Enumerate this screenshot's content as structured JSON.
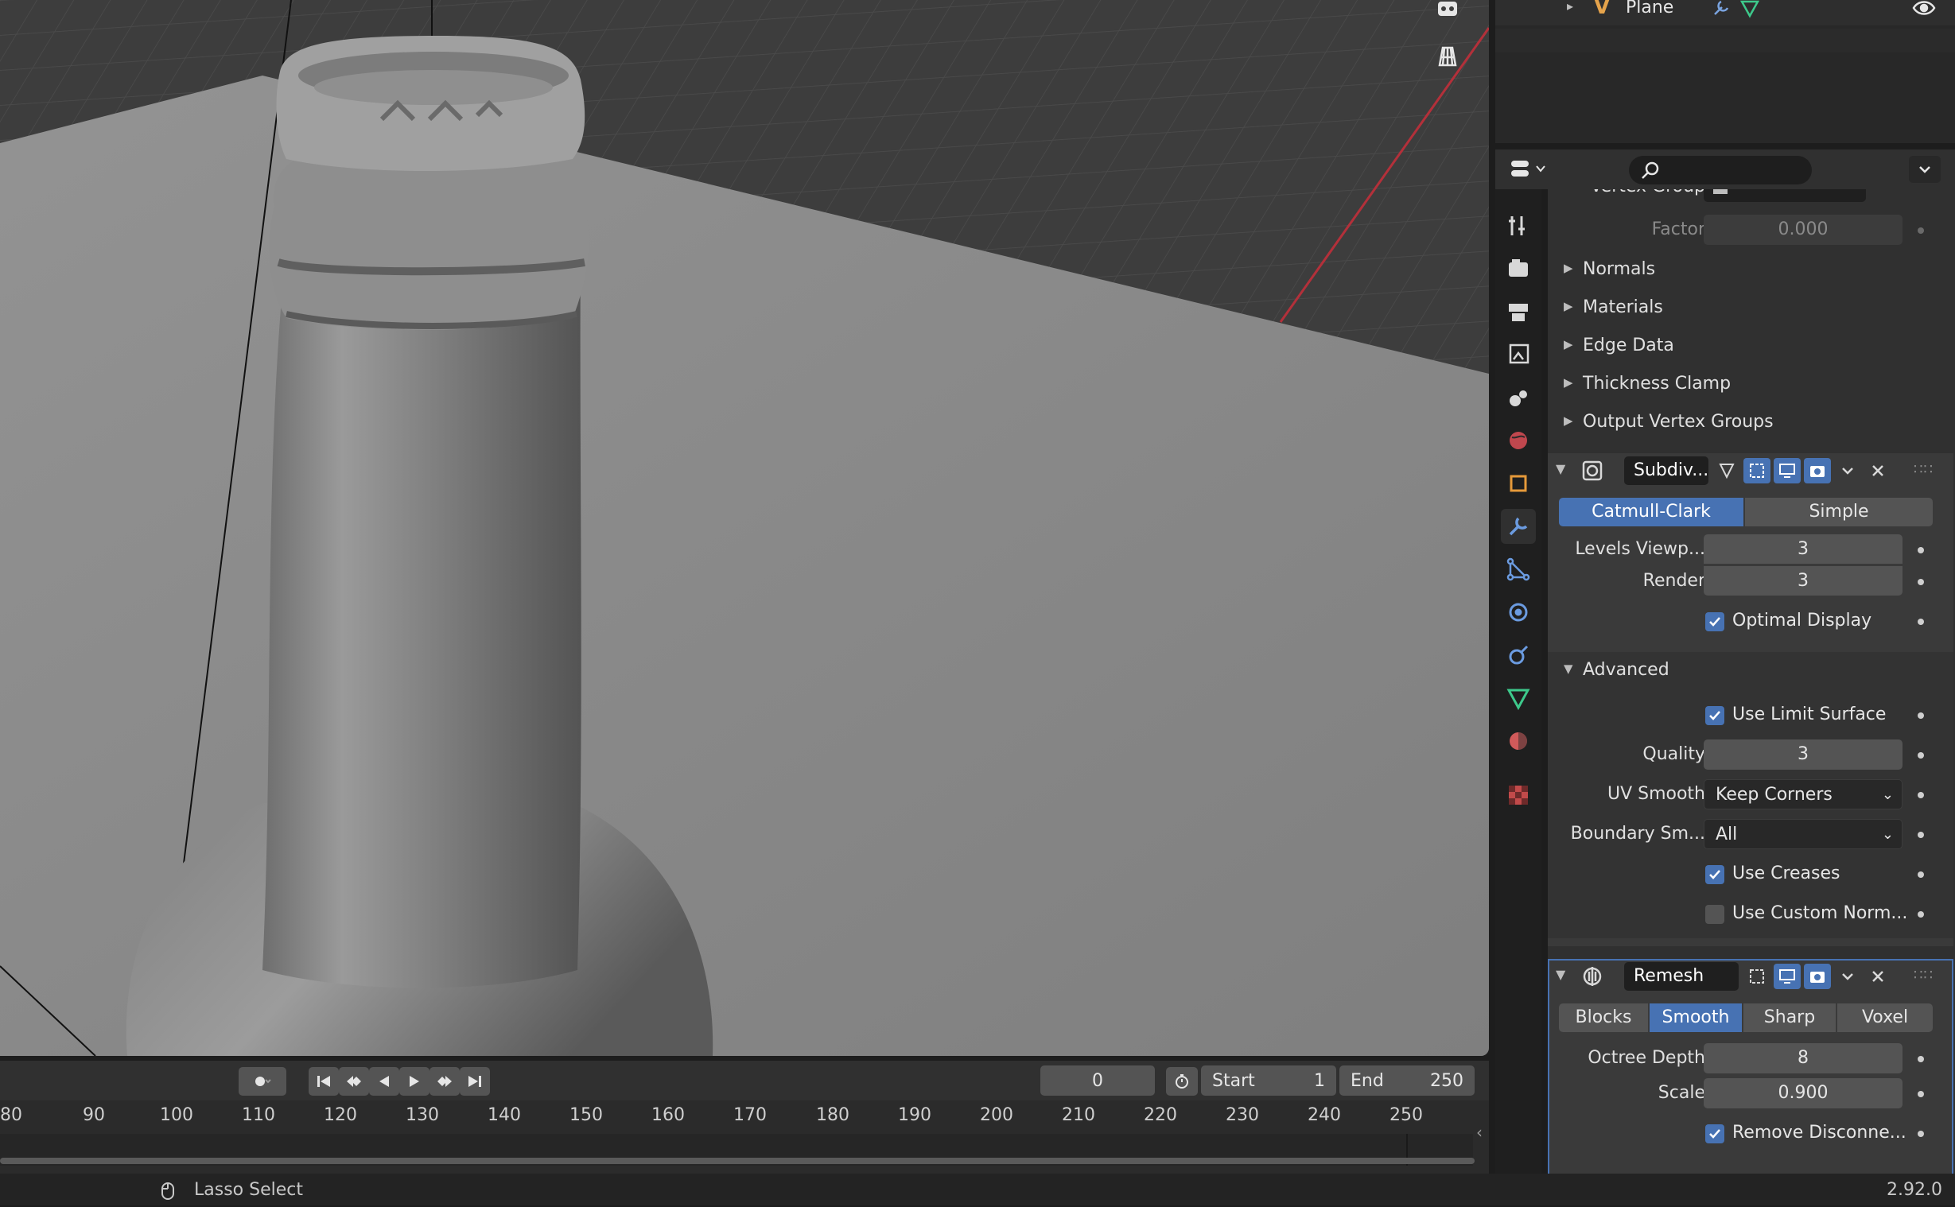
{
  "outliner": {
    "item_label": "Plane"
  },
  "props": {
    "search_placeholder": "",
    "solidify": {
      "vertex_group_label": "Vertex Group",
      "factor_label": "Factor",
      "factor_value": "0.000",
      "subpanels": [
        "Normals",
        "Materials",
        "Edge Data",
        "Thickness Clamp",
        "Output Vertex Groups"
      ]
    },
    "subdiv": {
      "name": "Subdiv...",
      "mode_options": [
        "Catmull-Clark",
        "Simple"
      ],
      "mode_selected": "Catmull-Clark",
      "levels_viewport_label": "Levels Viewp...",
      "levels_viewport_value": "3",
      "render_label": "Render",
      "render_value": "3",
      "optimal_display_label": "Optimal Display",
      "advanced_label": "Advanced",
      "use_limit_surface_label": "Use Limit Surface",
      "quality_label": "Quality",
      "quality_value": "3",
      "uv_smooth_label": "UV Smooth",
      "uv_smooth_value": "Keep Corners",
      "boundary_label": "Boundary Sm...",
      "boundary_value": "All",
      "use_creases_label": "Use Creases",
      "use_custom_normals_label": "Use Custom Norm...",
      "optimal_display": true,
      "use_limit_surface": true,
      "use_creases": true,
      "use_custom_normals": false
    },
    "remesh": {
      "name": "Remesh",
      "mode_options": [
        "Blocks",
        "Smooth",
        "Sharp",
        "Voxel"
      ],
      "mode_selected": "Smooth",
      "octree_label": "Octree Depth",
      "octree_value": "8",
      "scale_label": "Scale",
      "scale_value": "0.900",
      "remove_disconnected_label": "Remove Disconne...",
      "remove_disconnected": true
    }
  },
  "timeline": {
    "current_frame": "0",
    "start_label": "Start",
    "start_value": "1",
    "end_label": "End",
    "end_value": "250",
    "ticks": [
      "80",
      "90",
      "100",
      "110",
      "120",
      "130",
      "140",
      "150",
      "160",
      "170",
      "180",
      "190",
      "200",
      "210",
      "220",
      "230",
      "240",
      "250"
    ]
  },
  "status": {
    "tool_hint": "Lasso Select",
    "version": "2.92.0"
  },
  "colors": {
    "accent": "#4772b3",
    "viewport_bg": "#3d3d3d",
    "plane": "#8c8c8c",
    "x_axis": "#b3303a"
  }
}
